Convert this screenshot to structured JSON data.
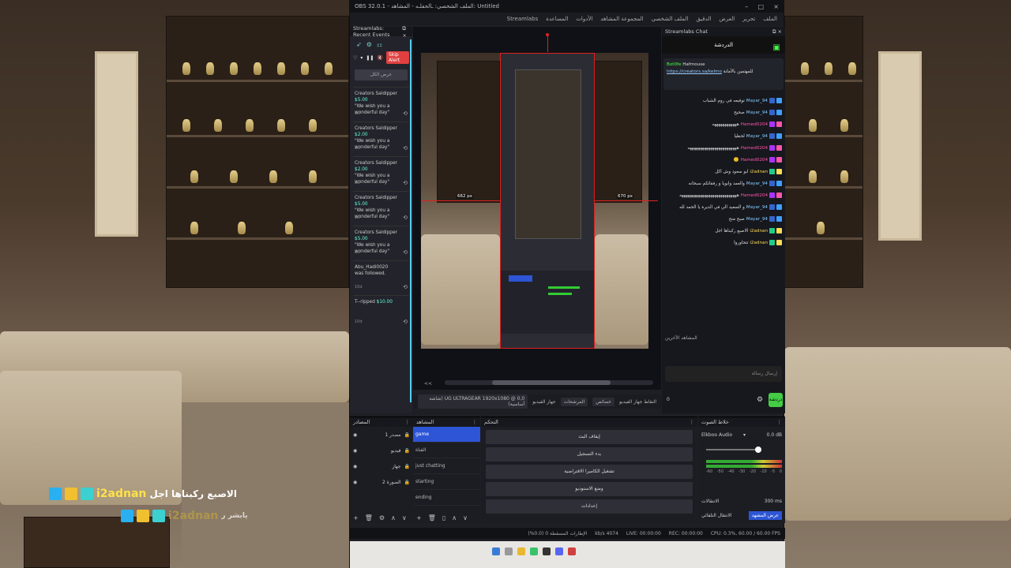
{
  "window": {
    "title": "OBS 32.0.1 - الملف الشخصي: ـالحفلـه - المشاهد: Untitled",
    "minimize": "–",
    "maximize": "□",
    "close": "×"
  },
  "menu": [
    "الملف",
    "تحرير",
    "العرض",
    "الدقيق",
    "الملف الشخصي",
    "المجموعة المشاهد",
    "الأدوات",
    "المساعدة",
    "Streamlabs"
  ],
  "events_dock": {
    "title": "Streamlabs: Recent Events",
    "skip_alert": "Skip Alert",
    "button": "عرض الكل",
    "items": [
      {
        "name": "Creators Saldipper",
        "amount": "$5.00",
        "message": "\"We wish you a wonderful day\"",
        "time": "8d"
      },
      {
        "name": "Creators Saldipper",
        "amount": "$2.00",
        "message": "\"We wish you a wonderful day\"",
        "time": "8d"
      },
      {
        "name": "Creators Saldipper",
        "amount": "$2.00",
        "message": "\"We wish you a wonderful day\"",
        "time": "8d"
      },
      {
        "name": "Creators Saldipper",
        "amount": "$5.00",
        "message": "\"We wish you a wonderful day\"",
        "time": "8d"
      },
      {
        "name": "Creators Saldipper",
        "amount": "$5.00",
        "message": "\"We wish you a wonderful day\"",
        "time": "8d"
      },
      {
        "name": "Abu_Hadi0020",
        "amount": "",
        "message": "was followed.",
        "time": "10d"
      },
      {
        "name": "T--ripped",
        "amount": "$10.00",
        "message": "",
        "time": "10d"
      }
    ]
  },
  "preview": {
    "guide_left": "662 px",
    "guide_right": "670 px",
    "scroll_left": "<<"
  },
  "source_bar": {
    "source_name": "التقاط جهاز الفيديو",
    "properties": "خصائص",
    "filters": "المرشحات",
    "device_label": "جهاز الفيديو",
    "device_value": "UG ULTRAGEAR 1920x1080 @ 0,0 (شاشة أساسية)"
  },
  "chat_dock": {
    "title": "Streamlabs Chat",
    "header": "الدردشة",
    "pinned_user": "Bot0fe",
    "pinned_text": "Hafmouse",
    "pinned_link": "https://creators.sa/kelmo",
    "pinned_suffix": "للمهتمين بالأمانة",
    "messages": [
      {
        "user": "Mayar_94",
        "text": "توقيعه في روم الشباب",
        "color": "blue"
      },
      {
        "user": "Mayar_94",
        "text": "صحيح",
        "color": "blue"
      },
      {
        "user": "Hamed0204",
        "text": "ههههههههههههه",
        "color": "pink"
      },
      {
        "user": "Mayar_94",
        "text": "لحظيا",
        "color": "blue"
      },
      {
        "user": "Hamed0204",
        "text": "ههههههههههههههههههههههههه",
        "color": "pink"
      },
      {
        "user": "Hamed0204",
        "text": "🙂",
        "color": "pink"
      },
      {
        "user": "i2adnan",
        "text": "ابو سعود وش اكل",
        "color": "yellow"
      },
      {
        "user": "Mayar_94",
        "text": "والعمد وابويا و رفقاتكم سبحانه",
        "color": "blue"
      },
      {
        "user": "Hamed0204",
        "text": "ههههههههههههههههههههههههههههه",
        "color": "pink"
      },
      {
        "user": "Mayar_94",
        "text": "و السعيد الي في الديرة يا الحمد لله",
        "color": "blue"
      },
      {
        "user": "Mayar_94",
        "text": "صبح منح",
        "color": "blue"
      },
      {
        "user": "i2adnan",
        "text": "الاصبع ركبناها اجل",
        "color": "yellow"
      },
      {
        "user": "i2adnan",
        "text": "تتحاوروا",
        "color": "yellow"
      }
    ],
    "send_as": "المشاهد الآخرين",
    "input_placeholder": "إرسال رسالة",
    "chat_button": "دردشة",
    "viewer_count": "0"
  },
  "scene_sources": {
    "title": "المصادر",
    "items": [
      "مصدر 1",
      "فيديو",
      "جهاز",
      "الصورة 2"
    ]
  },
  "scenes": {
    "title": "المشاهد",
    "items": [
      "game",
      "القناة",
      "just chatting",
      "starting",
      "ending"
    ],
    "selected": 0
  },
  "controls": {
    "title": "التحكم",
    "buttons": [
      "إيقاف البث",
      "بدء التسجيل",
      "تشغيل الكاميرا الافتراضية",
      "وضع الاستوديو",
      "إعدادات"
    ]
  },
  "audio": {
    "title": "خلاط الصوت",
    "device": "Elkboo Audio",
    "level": "0.0 dB",
    "scale": [
      "-60",
      "-50",
      "-40",
      "-30",
      "-20",
      "-10",
      "-5",
      "0"
    ],
    "transitions_label": "الانتقالات",
    "duration": "300 ms",
    "scene_transition": "عرض المشهد",
    "transition_name": "الانتقال التلقائي"
  },
  "status": {
    "dropped": "الإطارات المسقطة 0 (0.0%)",
    "live": "LIVE: 00:00:00",
    "rec": "REC: 00:00:00",
    "bitrate": "4074 kb/s",
    "cpu": "CPU: 0.3%, 60.00 / 60.00 FPS"
  },
  "overlay": {
    "alert_name": "i2adnan",
    "alert_message": "الاصبع ركبناها اجل",
    "alert2_name": "i2adnan",
    "alert2_message": "يابشر ر"
  }
}
